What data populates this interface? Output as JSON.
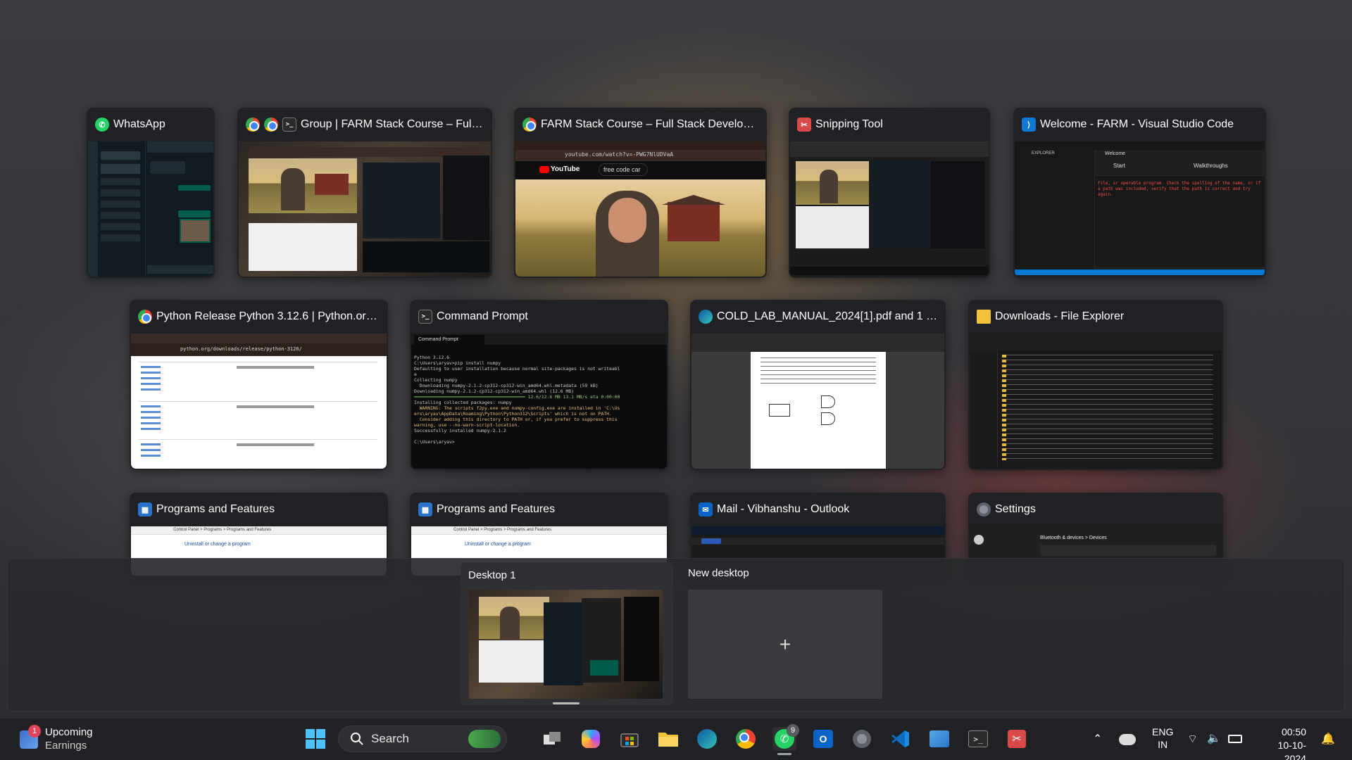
{
  "windows": [
    {
      "title": "WhatsApp",
      "icons": [
        "whatsapp-icon"
      ]
    },
    {
      "title": "Group | FARM Stack Course – Full S...",
      "icons": [
        "chrome-icon",
        "chrome-icon",
        "terminal-icon"
      ]
    },
    {
      "title": "FARM Stack Course – Full Stack Developm...",
      "icons": [
        "chrome-icon"
      ],
      "url": "youtube.com/watch?v=-PWG7NlUDVaA",
      "search": "free code car"
    },
    {
      "title": "Snipping Tool",
      "icons": [
        "snipping-tool-icon"
      ]
    },
    {
      "title": "Welcome - FARM - Visual Studio Code",
      "icons": [
        "vscode-icon"
      ],
      "tabs": [
        "EXPLORER",
        "Welcome"
      ],
      "start": "Start",
      "walkthroughs": "Walkthroughs",
      "terminal_text": "File, or operable program. Check the spelling of the name, or if a path was included, verify that the path is correct and try again."
    },
    {
      "title": "Python Release Python 3.12.6 | Python.org -...",
      "icons": [
        "chrome-icon"
      ],
      "url": "python.org/downloads/release/python-3126/"
    },
    {
      "title": "Command Prompt",
      "icons": [
        "terminal-icon"
      ],
      "lines": [
        "Python 3.12.6",
        "",
        "C:\\Users\\aryav>pip install numpy",
        "Defaulting to user installation because normal site-packages is not writeabl",
        "e",
        "Collecting numpy",
        "  Downloading numpy-2.1.2-cp312-cp312-win_amd64.whl.metadata (59 kB)",
        "Downloading numpy-2.1.2-cp312-cp312-win_amd64.whl (12.6 MB)",
        "",
        "Installing collected packages: numpy",
        "  WARNING: The scripts f2py.exe and numpy-config.exe are installed in 'C:\\Us",
        "ers\\aryav\\AppData\\Roaming\\Python\\Python312\\Scripts' which is not on PATH.",
        "  Consider adding this directory to PATH or, if you prefer to suppress this",
        "warning, use --no-warn-script-location.",
        "Successfully installed numpy-2.1.2",
        "",
        "C:\\Users\\aryav>"
      ],
      "progress": "12.6/12.6 MB 13.1 MB/s eta 0:00:00"
    },
    {
      "title": "COLD_LAB_MANUAL_2024[1].pdf and 1 mor...",
      "icons": [
        "edge-icon"
      ]
    },
    {
      "title": "Downloads - File Explorer",
      "icons": [
        "file-explorer-icon"
      ]
    },
    {
      "title": "Programs and Features",
      "icons": [
        "control-panel-icon"
      ],
      "crumb": "Control Panel > Programs > Programs and Features",
      "link": "Uninstall or change a program"
    },
    {
      "title": "Programs and Features",
      "icons": [
        "control-panel-icon"
      ],
      "crumb": "Control Panel > Programs > Programs and Features",
      "link": "Uninstall or change a program"
    },
    {
      "title": "Mail - Vibhanshu - Outlook",
      "icons": [
        "outlook-icon"
      ]
    },
    {
      "title": "Settings",
      "icons": [
        "settings-icon"
      ],
      "crumb": "Bluetooth & devices > Devices"
    }
  ],
  "desktops": {
    "current": "Desktop 1",
    "new": "New desktop",
    "new_symbol": "+"
  },
  "taskbar": {
    "widget_title": "Upcoming",
    "widget_subtitle": "Earnings",
    "widget_badge": "1",
    "search_placeholder": "Search",
    "whatsapp_badge": "9",
    "lang": "ENG",
    "region": "IN",
    "time": "00:50",
    "date": "10-10-2024"
  }
}
